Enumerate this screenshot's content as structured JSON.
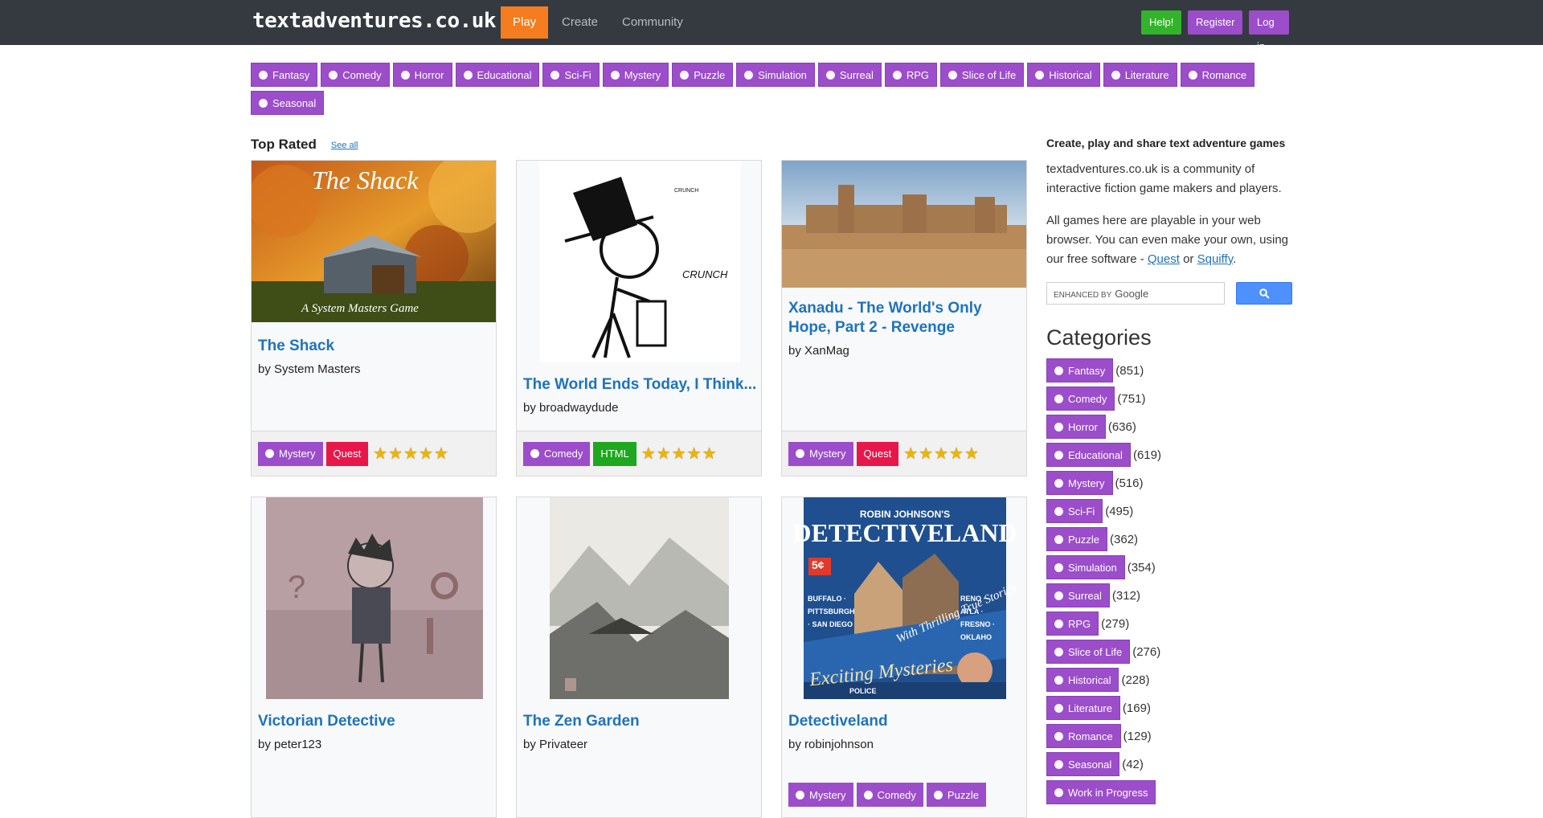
{
  "nav": {
    "logo": "textadventures.co.uk",
    "items": [
      "Play",
      "Create",
      "Community"
    ],
    "help": "Help!",
    "register": "Register",
    "login": "Log in"
  },
  "genres": [
    {
      "label": "Fantasy",
      "icon": "hat-icon"
    },
    {
      "label": "Comedy",
      "icon": "smile-icon"
    },
    {
      "label": "Horror",
      "icon": "spider-icon"
    },
    {
      "label": "Educational",
      "icon": "grad-cap-icon"
    },
    {
      "label": "Sci-Fi",
      "icon": "alien-icon"
    },
    {
      "label": "Mystery",
      "icon": "magnifier-icon"
    },
    {
      "label": "Puzzle",
      "icon": "puzzle-icon"
    },
    {
      "label": "Simulation",
      "icon": "gears-icon"
    },
    {
      "label": "Surreal",
      "icon": "swirl-icon"
    },
    {
      "label": "RPG",
      "icon": "dice-icon"
    },
    {
      "label": "Slice of Life",
      "icon": "walking-icon"
    },
    {
      "label": "Historical",
      "icon": "chess-rook-icon"
    },
    {
      "label": "Literature",
      "icon": "book-icon"
    },
    {
      "label": "Romance",
      "icon": "heart-icon"
    },
    {
      "label": "Seasonal",
      "icon": "gift-icon"
    }
  ],
  "top_rated": {
    "heading": "Top Rated",
    "see_all": "See all",
    "cards": [
      {
        "title": "The Shack",
        "author": "by System Masters",
        "genre": "Mystery",
        "engine": "Quest",
        "rating": 5,
        "image_caption": "The Shack",
        "image_sub": "A System Masters Game"
      },
      {
        "title": "The World Ends Today, I Think...",
        "author": "by broadwaydude",
        "genre": "Comedy",
        "engine": "HTML",
        "rating": 5,
        "image_text_1": "CRUNCH",
        "image_text_2": "CRUNCH"
      },
      {
        "title": "Xanadu - The World's Only Hope, Part 2 - Revenge",
        "author": "by XanMag",
        "genre": "Mystery",
        "engine": "Quest",
        "rating": 5
      },
      {
        "title": "Victorian Detective",
        "author": "by peter123"
      },
      {
        "title": "The Zen Garden",
        "author": "by Privateer"
      },
      {
        "title": "Detectiveland",
        "author": "by robinjohnson",
        "genres": [
          "Mystery",
          "Comedy",
          "Puzzle"
        ],
        "image_top": "ROBIN JOHNSON'S",
        "image_title": "DETECTIVELAND",
        "image_price": "5¢",
        "image_band": "With Thrilling True Stories",
        "image_bottom": "Exciting Mysteries",
        "image_cities_left": "BUFFALO · PITTSBURGH · SAN DIEGO",
        "image_cities_right": "RENO · ATLA · FRESNO · OKLAHO",
        "image_badge": "POLICE"
      }
    ]
  },
  "sidebar": {
    "title": "Create, play and share text adventure games",
    "p1": "textadventures.co.uk is a community of interactive fiction game makers and players.",
    "p2_before": "All games here are playable in your web browser. You can even make your own, using our free software - ",
    "link_quest": "Quest",
    "p2_or": " or ",
    "link_squiffy": "Squiffy",
    "p2_end": ".",
    "search_label": "ENHANCED BY",
    "search_brand": "Google",
    "categories_heading": "Categories",
    "categories": [
      {
        "label": "Fantasy",
        "count": "(851)"
      },
      {
        "label": "Comedy",
        "count": "(751)"
      },
      {
        "label": "Horror",
        "count": "(636)"
      },
      {
        "label": "Educational",
        "count": "(619)"
      },
      {
        "label": "Mystery",
        "count": "(516)"
      },
      {
        "label": "Sci-Fi",
        "count": "(495)"
      },
      {
        "label": "Puzzle",
        "count": "(362)"
      },
      {
        "label": "Simulation",
        "count": "(354)"
      },
      {
        "label": "Surreal",
        "count": "(312)"
      },
      {
        "label": "RPG",
        "count": "(279)"
      },
      {
        "label": "Slice of Life",
        "count": "(276)"
      },
      {
        "label": "Historical",
        "count": "(228)"
      },
      {
        "label": "Literature",
        "count": "(169)"
      },
      {
        "label": "Romance",
        "count": "(129)"
      },
      {
        "label": "Seasonal",
        "count": "(42)"
      },
      {
        "label": "Work in Progress",
        "count": ""
      }
    ]
  },
  "colors": {
    "nav_bg": "#343a40",
    "accent_orange": "#f57c1f",
    "tag_purple": "#9b4dca",
    "quest_red": "#e8174a",
    "html_green": "#1fa71f",
    "help_green": "#32b32b",
    "link_blue": "#1e73be"
  }
}
